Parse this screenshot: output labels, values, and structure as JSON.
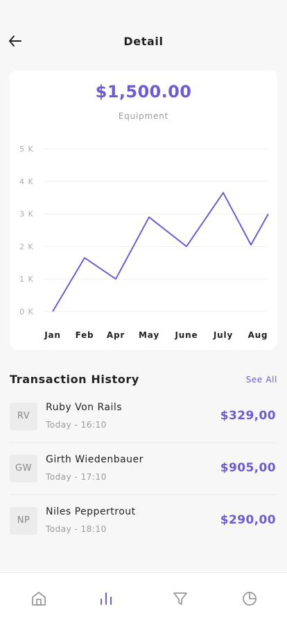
{
  "header": {
    "title": "Detail",
    "back_icon": "arrow-left-icon"
  },
  "summary": {
    "amount": "$1,500.00",
    "category": "Equipment"
  },
  "chart_data": {
    "type": "line",
    "categories": [
      "Jan",
      "Feb",
      "Apr",
      "May",
      "June",
      "July",
      "Aug"
    ],
    "x_positions": [
      0,
      1,
      2,
      3,
      4,
      5,
      5.8,
      6.3
    ],
    "values": [
      0,
      1.65,
      1.0,
      2.9,
      2.0,
      3.65,
      2.05,
      3.0
    ],
    "y_ticks": [
      "0 K",
      "1 K",
      "2 K",
      "3 K",
      "4 K",
      "5 K"
    ],
    "ylim": [
      0,
      5
    ],
    "grid": true,
    "line_color": "#6d5bcf"
  },
  "transactions": {
    "title": "Transaction History",
    "see_all": "See All",
    "items": [
      {
        "initials": "RV",
        "name": "Ruby Von Rails",
        "time": "Today - 16:10",
        "amount": "$329,00"
      },
      {
        "initials": "GW",
        "name": "Girth Wiedenbauer",
        "time": "Today - 17:10",
        "amount": "$905,00"
      },
      {
        "initials": "NP",
        "name": "Niles Peppertrout",
        "time": "Today - 18:10",
        "amount": "$290,00"
      }
    ]
  },
  "nav": {
    "items": [
      {
        "icon": "home-icon",
        "active": false
      },
      {
        "icon": "bar-chart-icon",
        "active": true
      },
      {
        "icon": "filter-icon",
        "active": false
      },
      {
        "icon": "pie-chart-icon",
        "active": false
      }
    ]
  },
  "colors": {
    "accent": "#6d5bcf",
    "text": "#222222",
    "muted": "#999999",
    "background": "#f7f7f7"
  }
}
